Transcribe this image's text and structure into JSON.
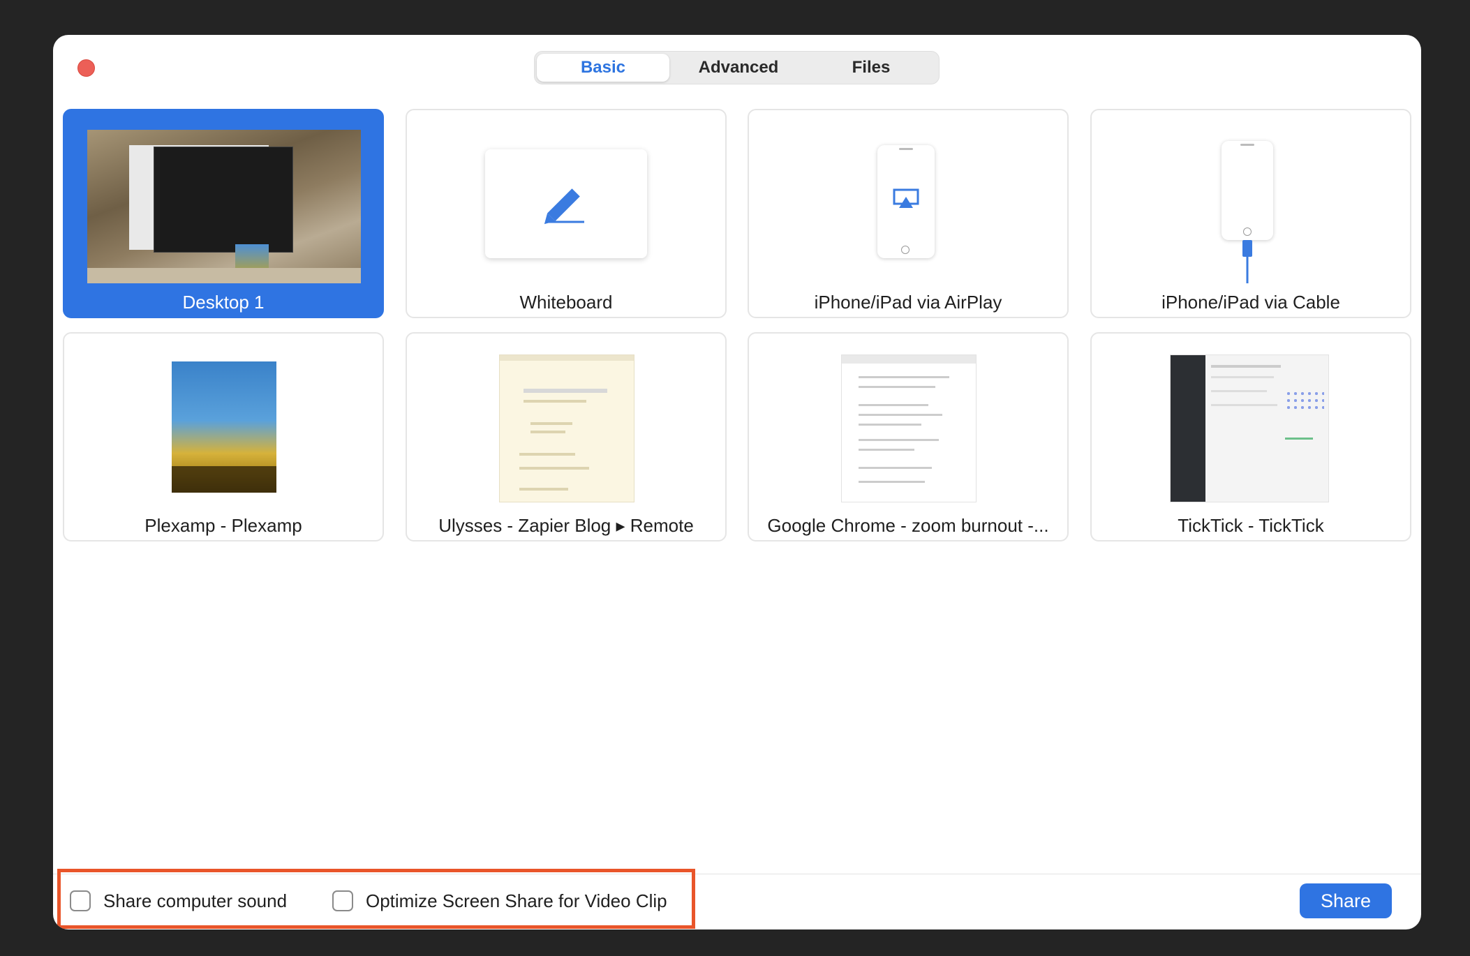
{
  "tabs": [
    {
      "label": "Basic",
      "active": true
    },
    {
      "label": "Advanced",
      "active": false
    },
    {
      "label": "Files",
      "active": false
    }
  ],
  "share_options": [
    {
      "label": "Desktop 1",
      "selected": true,
      "icon": "desktop-thumbnail"
    },
    {
      "label": "Whiteboard",
      "selected": false,
      "icon": "pencil-icon"
    },
    {
      "label": "iPhone/iPad via AirPlay",
      "selected": false,
      "icon": "airplay-icon"
    },
    {
      "label": "iPhone/iPad via Cable",
      "selected": false,
      "icon": "cable-icon"
    },
    {
      "label": "Plexamp - Plexamp",
      "selected": false,
      "icon": "app-thumbnail"
    },
    {
      "label": "Ulysses - Zapier Blog ▸ Remote",
      "selected": false,
      "icon": "app-thumbnail"
    },
    {
      "label": "Google Chrome - zoom burnout -...",
      "selected": false,
      "icon": "app-thumbnail"
    },
    {
      "label": "TickTick - TickTick",
      "selected": false,
      "icon": "app-thumbnail"
    }
  ],
  "footer": {
    "share_sound_label": "Share computer sound",
    "share_sound_checked": false,
    "optimize_label": "Optimize Screen Share for Video Clip",
    "optimize_checked": false,
    "share_button_label": "Share"
  },
  "colors": {
    "accent": "#2f74e2",
    "close_button": "#ec5f57",
    "highlight_box": "#e9552a"
  }
}
